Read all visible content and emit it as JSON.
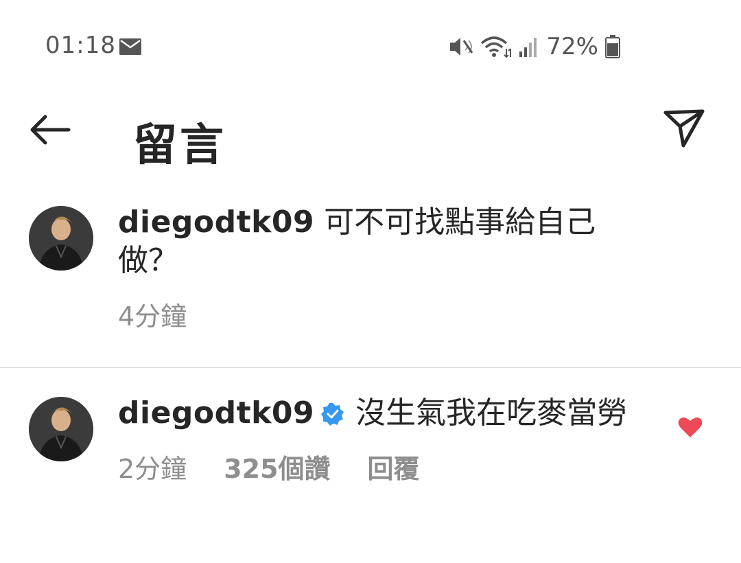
{
  "status_bar": {
    "time": "01:18",
    "battery": "72%",
    "icons": [
      "mail-icon",
      "mute-icon",
      "wifi-icon",
      "signal-icon",
      "battery-icon"
    ]
  },
  "header": {
    "title": "留言",
    "back_icon": "back-arrow-icon",
    "send_icon": "send-icon"
  },
  "comments": [
    {
      "username": "diegodtk09",
      "verified": false,
      "text": "可不可找點事給自己做？",
      "time": "4分鐘",
      "likes": "",
      "reply": "",
      "liked": false
    },
    {
      "username": "diegodtk09",
      "verified": true,
      "text": "沒生氣我在吃麥當勞",
      "time": "2分鐘",
      "likes": "325個讚",
      "reply": "回覆",
      "liked": true
    }
  ],
  "colors": {
    "verified": "#3897f0",
    "like": "#ed4956",
    "meta_text": "#8e8e8e",
    "primary_text": "#262626"
  }
}
